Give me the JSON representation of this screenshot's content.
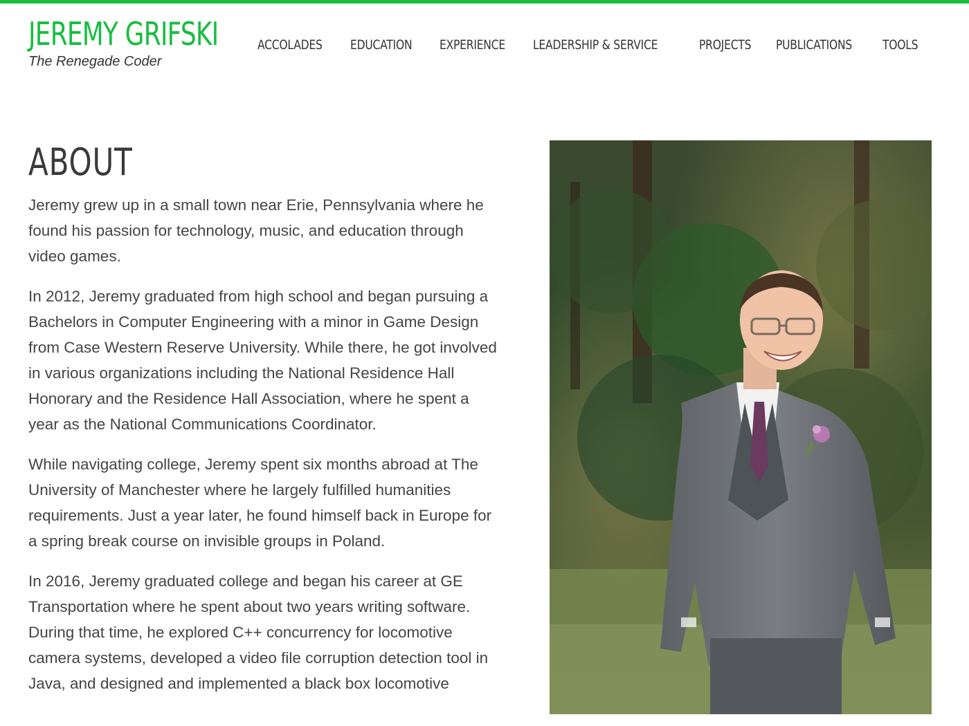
{
  "site": {
    "name": "JEREMY GRIFSKI",
    "tagline": "The Renegade Coder",
    "accent_color": "#17bd3f"
  },
  "nav": {
    "items": [
      {
        "label": "ACCOLADES"
      },
      {
        "label": "EDUCATION"
      },
      {
        "label": "EXPERIENCE"
      },
      {
        "label": "LEADERSHIP & SERVICE"
      },
      {
        "label": "PROJECTS"
      },
      {
        "label": "PUBLICATIONS"
      },
      {
        "label": "TOOLS"
      }
    ]
  },
  "about": {
    "title": "ABOUT",
    "paragraphs": [
      "Jeremy grew up in a small town near Erie, Pennsylvania where he found his passion for technology, music, and education through video games.",
      "In 2012, Jeremy graduated from high school and began pursuing a Bachelors in Computer Engineering with a minor in Game Design from Case Western Reserve University. While there, he got involved in various organizations including the National Residence Hall Honorary and the Residence Hall Association, where he spent a year as the National Communications Coordinator.",
      "While navigating college, Jeremy spent six months abroad at The University of Manchester where he largely fulfilled humanities requirements. Just a year later, he found himself back in Europe for a spring break course on invisible groups in Poland.",
      "In 2016, Jeremy graduated college and began his career at GE Transportation where he spent about two years writing software. During that time, he explored C++ concurrency for locomotive camera systems, developed a video file corruption detection tool in Java, and designed and implemented a black box locomotive"
    ]
  },
  "photo": {
    "icon": "portrait-photo"
  }
}
